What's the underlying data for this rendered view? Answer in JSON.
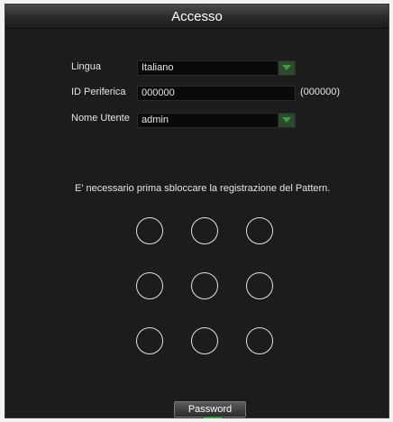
{
  "window": {
    "title": "Accesso"
  },
  "form": {
    "language": {
      "label": "Lingua",
      "value": "Italiano"
    },
    "device_id": {
      "label": "ID Periferica",
      "value": "000000",
      "hint": "(000000)"
    },
    "username": {
      "label": "Nome Utente",
      "value": "admin"
    }
  },
  "pattern": {
    "message": "E' necessario prima sbloccare la registrazione del Pattern.",
    "rows": 3,
    "cols": 3
  },
  "buttons": {
    "password": "Password"
  },
  "colors": {
    "background": "#1c1c1c",
    "title_bar": "#2a2a2a",
    "dropdown_accent": "#3f9a3f",
    "text": "#e6e6e6"
  }
}
